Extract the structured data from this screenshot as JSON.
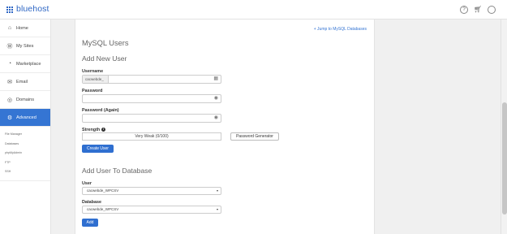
{
  "brand": {
    "name": "bluehost",
    "color": "#2f67c4"
  },
  "header": {
    "icons": [
      "help-icon",
      "cart-icon",
      "user-icon"
    ]
  },
  "sidebar": {
    "items": [
      {
        "label": "Home",
        "icon": "home-icon"
      },
      {
        "label": "My Sites",
        "icon": "wordpress-icon"
      },
      {
        "label": "Marketplace",
        "icon": "marketplace-icon"
      },
      {
        "label": "Email",
        "icon": "email-icon"
      },
      {
        "label": "Domains",
        "icon": "globe-icon"
      },
      {
        "label": "Advanced",
        "icon": "gear-icon",
        "active": true
      }
    ],
    "sub_items": [
      "File Manager",
      "Databases",
      "phpMyAdmin",
      "FTP",
      "SSH"
    ],
    "accent": "#3575d3"
  },
  "main": {
    "jump_link": "+ Jump to MySQL Databases",
    "title": "MySQL Users",
    "add_user": {
      "heading": "Add New User",
      "username_label": "Username",
      "username_prefix": "cacwebde_",
      "username_value": "",
      "password_label": "Password",
      "password_again_label": "Password (Again)",
      "strength_label": "Strength",
      "strength_value": "Very Weak (0/100)",
      "password_generator_button": "Password Generator",
      "create_button": "Create User"
    },
    "add_to_db": {
      "heading": "Add User To Database",
      "user_label": "User",
      "user_selected": "cacwebde_WPCSV",
      "database_label": "Database",
      "database_selected": "cacwebde_WPCSV",
      "add_button": "Add"
    }
  }
}
